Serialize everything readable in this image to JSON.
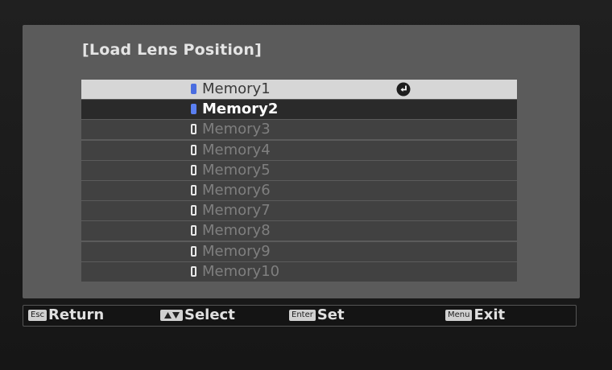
{
  "menu": {
    "title": "[Load Lens Position]",
    "items": [
      {
        "label": "Memory1",
        "state": "selected"
      },
      {
        "label": "Memory2",
        "state": "active"
      },
      {
        "label": "Memory3",
        "state": "empty"
      },
      {
        "label": "Memory4",
        "state": "empty"
      },
      {
        "label": "Memory5",
        "state": "empty"
      },
      {
        "label": "Memory6",
        "state": "empty"
      },
      {
        "label": "Memory7",
        "state": "empty"
      },
      {
        "label": "Memory8",
        "state": "empty"
      },
      {
        "label": "Memory9",
        "state": "empty"
      },
      {
        "label": "Memory10",
        "state": "empty"
      }
    ],
    "selected_icon": "enter-return-icon"
  },
  "footer": {
    "return": {
      "key": "Esc",
      "label": "Return"
    },
    "select": {
      "key_icon": "up-down-arrows-icon",
      "label": "Select"
    },
    "set": {
      "key": "Enter",
      "label": "Set"
    },
    "exit": {
      "key": "Menu",
      "label": "Exit"
    }
  },
  "colors": {
    "panel": "#5b5b5b",
    "row": "#414141",
    "selected_row": "#d6d6d6",
    "memory_indicator": "#4a6de0"
  }
}
